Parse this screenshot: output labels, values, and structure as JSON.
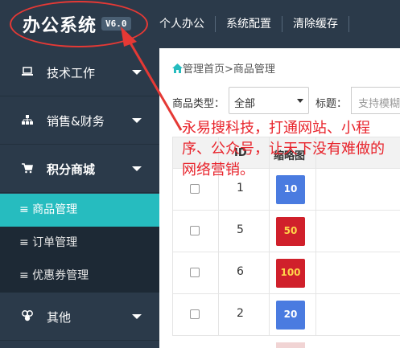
{
  "header": {
    "logo": "办公系统",
    "version": "V6.0",
    "nav": [
      "个人办公",
      "系统配置",
      "清除缓存"
    ]
  },
  "sidebar": {
    "groups": [
      {
        "label": "技术工作",
        "icon": "laptop-icon"
      },
      {
        "label": "销售&财务",
        "icon": "sitemap-icon"
      },
      {
        "label": "积分商城",
        "icon": "cart-icon"
      },
      {
        "label": "其他",
        "icon": "cubes-icon"
      }
    ],
    "submenu": [
      "≡ 商品管理",
      "≡ 订单管理",
      "≡ 优惠券管理"
    ],
    "active_sub": 0
  },
  "breadcrumb": {
    "home": "管理首页",
    "separator": ">",
    "current": "商品管理"
  },
  "filter": {
    "type_label": "商品类型：",
    "type_value": "全部",
    "title_label": "标题：",
    "title_placeholder": "支持模糊"
  },
  "table": {
    "headers": [
      "ID",
      "缩略图"
    ],
    "rows": [
      {
        "id": "1",
        "thumb": "10",
        "thumb_style": "blue"
      },
      {
        "id": "5",
        "thumb": "50",
        "thumb_style": "red"
      },
      {
        "id": "6",
        "thumb": "100",
        "thumb_style": "red"
      },
      {
        "id": "2",
        "thumb": "20",
        "thumb_style": "blue"
      }
    ]
  },
  "annotation": {
    "text": "永易搜科技，打通网站、小程序、公众号，让天下没有难做的网络营销。"
  },
  "colors": {
    "sidebar_bg": "#2b3a4a",
    "active": "#26bcbf",
    "annotation": "#e53935"
  }
}
